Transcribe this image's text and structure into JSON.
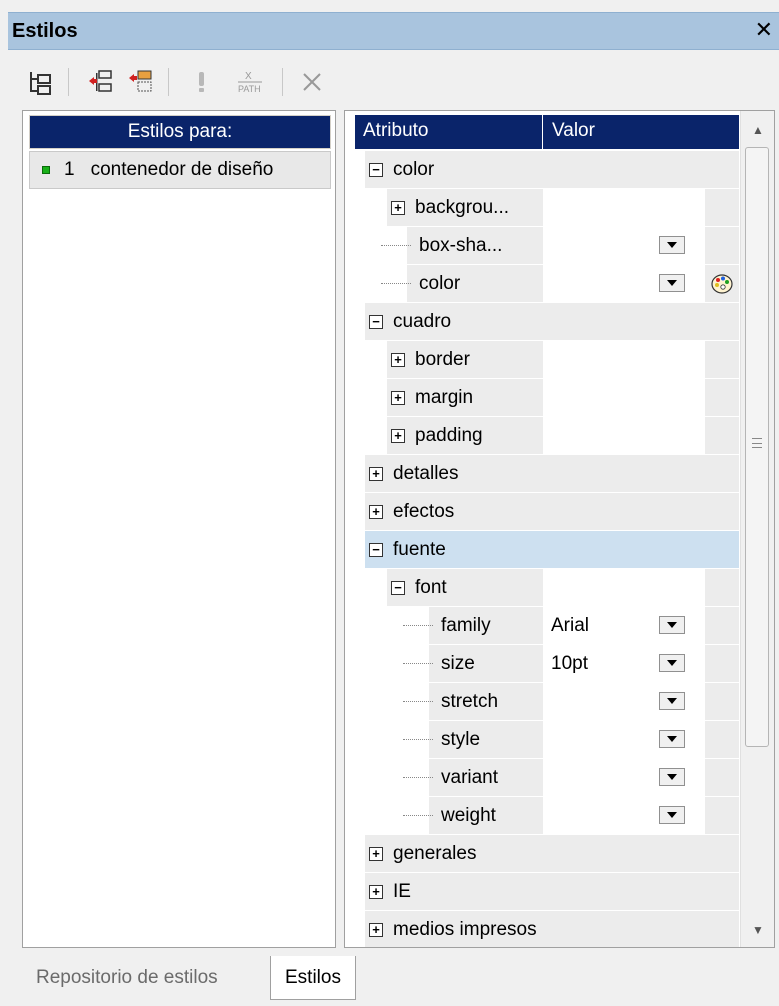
{
  "window": {
    "title": "Estilos",
    "close_glyph": "✕"
  },
  "toolbar": {
    "icons": [
      "tree-layout-icon",
      "add-style-icon",
      "add-rule-icon",
      "exclamation-icon",
      "xpath-icon",
      "delete-icon"
    ],
    "xpath_label": "PATH"
  },
  "left": {
    "header": "Estilos para:",
    "rows": [
      {
        "num": "1",
        "label": "contenedor de diseño"
      }
    ]
  },
  "grid": {
    "col_attr": "Atributo",
    "col_val": "Valor",
    "rows": [
      {
        "label": "color",
        "kind": "group",
        "exp": "−"
      },
      {
        "label": "backgrou...",
        "kind": "child-exp",
        "exp": "+"
      },
      {
        "label": "box-sha...",
        "kind": "child",
        "dropdown": true
      },
      {
        "label": "color",
        "kind": "child",
        "dropdown": true,
        "palette": true
      },
      {
        "label": "cuadro",
        "kind": "group",
        "exp": "−"
      },
      {
        "label": "border",
        "kind": "child-exp",
        "exp": "+"
      },
      {
        "label": "margin",
        "kind": "child-exp",
        "exp": "+"
      },
      {
        "label": "padding",
        "kind": "child-exp",
        "exp": "+"
      },
      {
        "label": "detalles",
        "kind": "group",
        "exp": "+"
      },
      {
        "label": "efectos",
        "kind": "group",
        "exp": "+"
      },
      {
        "label": "fuente",
        "kind": "group",
        "exp": "−",
        "selected": true
      },
      {
        "label": "font",
        "kind": "child-exp",
        "exp": "−"
      },
      {
        "label": "family",
        "kind": "grandchild",
        "value": "Arial",
        "dropdown": true
      },
      {
        "label": "size",
        "kind": "grandchild",
        "value": "10pt",
        "dropdown": true
      },
      {
        "label": "stretch",
        "kind": "grandchild",
        "dropdown": true
      },
      {
        "label": "style",
        "kind": "grandchild",
        "dropdown": true
      },
      {
        "label": "variant",
        "kind": "grandchild",
        "dropdown": true
      },
      {
        "label": "weight",
        "kind": "grandchild",
        "dropdown": true
      },
      {
        "label": "generales",
        "kind": "group",
        "exp": "+"
      },
      {
        "label": "IE",
        "kind": "group",
        "exp": "+"
      },
      {
        "label": "medios impresos",
        "kind": "group",
        "exp": "+"
      }
    ]
  },
  "tabs": {
    "inactive": "Repositorio de estilos",
    "active": "Estilos"
  }
}
